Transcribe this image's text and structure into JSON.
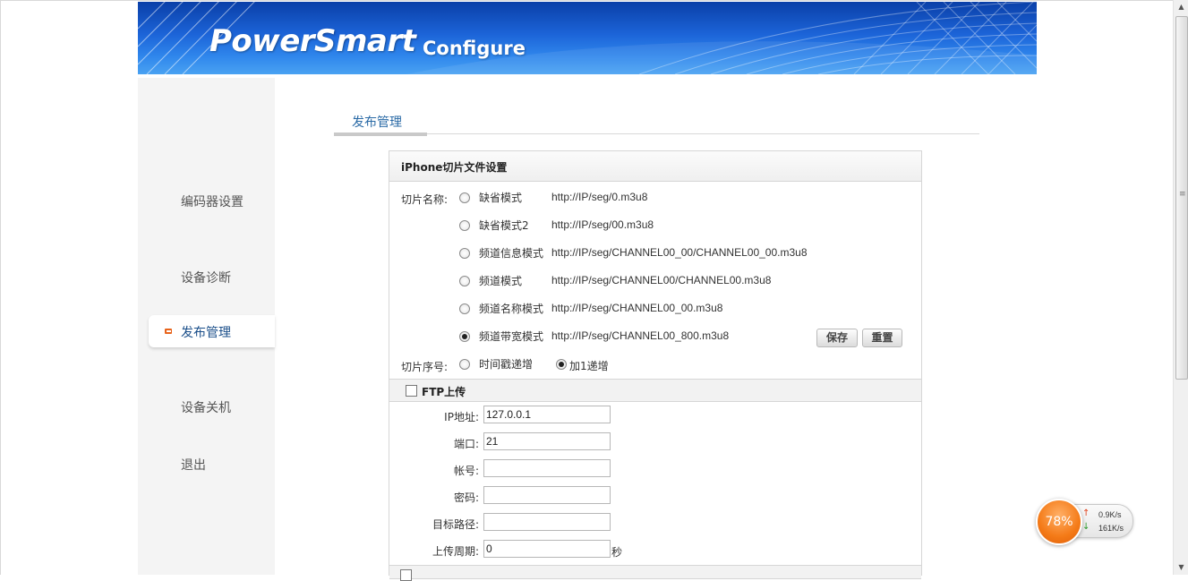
{
  "header": {
    "brand": "PowerSmart",
    "subtitle": "Configure"
  },
  "sidebar": {
    "items": [
      {
        "label": "编码器设置"
      },
      {
        "label": "设备诊断"
      },
      {
        "label": "发布管理",
        "active": true
      },
      {
        "label": "设备关机"
      },
      {
        "label": "退出"
      }
    ]
  },
  "main": {
    "tab_label": "发布管理"
  },
  "panel": {
    "title": "iPhone切片文件设置",
    "slice_name_label": "切片名称:",
    "modes": [
      {
        "name": "缺省模式",
        "url": "http://IP/seg/0.m3u8",
        "selected": false
      },
      {
        "name": "缺省模式2",
        "url": "http://IP/seg/00.m3u8",
        "selected": false
      },
      {
        "name": "频道信息模式",
        "url": "http://IP/seg/CHANNEL00_00/CHANNEL00_00.m3u8",
        "selected": false
      },
      {
        "name": "频道模式",
        "url": "http://IP/seg/CHANNEL00/CHANNEL00.m3u8",
        "selected": false
      },
      {
        "name": "频道名称模式",
        "url": "http://IP/seg/CHANNEL00_00.m3u8",
        "selected": false
      },
      {
        "name": "频道带宽模式",
        "url": "http://IP/seg/CHANNEL00_800.m3u8",
        "selected": true
      }
    ],
    "save_label": "保存",
    "reset_label": "重置",
    "seq_label": "切片序号:",
    "seq_options": [
      {
        "label": "时间戳递增",
        "selected": false
      },
      {
        "label": "加1递增",
        "selected": true
      }
    ]
  },
  "ftp": {
    "title": "FTP上传",
    "checked": false,
    "fields": [
      {
        "label": "IP地址:",
        "value": "127.0.0.1"
      },
      {
        "label": "端口:",
        "value": "21"
      },
      {
        "label": "帐号:",
        "value": ""
      },
      {
        "label": "密码:",
        "value": ""
      },
      {
        "label": "目标路径:",
        "value": ""
      },
      {
        "label": "上传周期:",
        "value": "0"
      }
    ],
    "period_unit": "秒"
  },
  "widget": {
    "percent": "78%",
    "up_speed": "0.9K/s",
    "down_speed": "161K/s"
  },
  "colors": {
    "accent": "#e8641c",
    "link": "#2a6aa6",
    "banner": "#1c64d8"
  }
}
